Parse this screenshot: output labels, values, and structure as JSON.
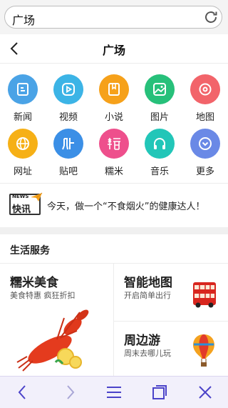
{
  "address_bar": {
    "value": "广场"
  },
  "header": {
    "title": "广场"
  },
  "grid_items": [
    {
      "label": "新闻",
      "icon": "news-icon",
      "color": "#4aa3e6"
    },
    {
      "label": "视频",
      "icon": "video-icon",
      "color": "#3cb4e6"
    },
    {
      "label": "小说",
      "icon": "book-icon",
      "color": "#f6a11a"
    },
    {
      "label": "图片",
      "icon": "image-icon",
      "color": "#27c07a"
    },
    {
      "label": "地图",
      "icon": "map-pin-icon",
      "color": "#f2646a"
    },
    {
      "label": "网址",
      "icon": "globe-icon",
      "color": "#f6b016"
    },
    {
      "label": "贴吧",
      "icon": "tieba-icon",
      "color": "#3b8fe6"
    },
    {
      "label": "糯米",
      "icon": "nuomi-icon",
      "color": "#ee4f8c"
    },
    {
      "label": "音乐",
      "icon": "headphones-icon",
      "color": "#22c6b8"
    },
    {
      "label": "更多",
      "icon": "chevron-down-icon",
      "color": "#6a89e6"
    }
  ],
  "news_ticker": {
    "logo_small": "NEWS",
    "logo_main": "快讯",
    "text": "今天，做一个“不食烟火”的健康达人！"
  },
  "life_services": {
    "title": "生活服务",
    "cards": [
      {
        "title": "糯米美食",
        "subtitle": "美食特惠 疯狂折扣"
      },
      {
        "title": "智能地图",
        "subtitle": "开启简单出行"
      },
      {
        "title": "周边游",
        "subtitle": "周末去哪儿玩"
      }
    ]
  },
  "toolbar": {
    "buttons": [
      "back-arrow-icon",
      "forward-arrow-icon",
      "menu-icon",
      "tabs-icon",
      "close-icon"
    ]
  }
}
